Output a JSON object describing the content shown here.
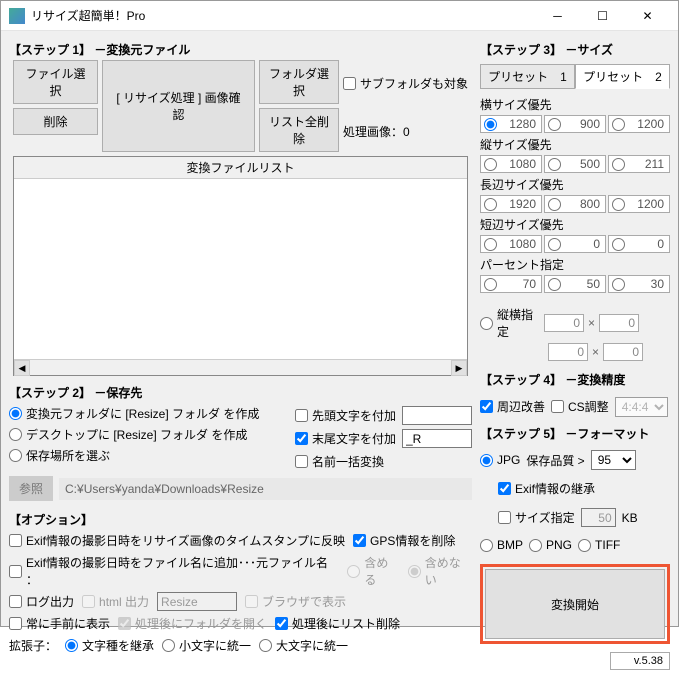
{
  "window": {
    "title": "リサイズ超簡単！Pro"
  },
  "step1": {
    "title": "【ステップ 1】 －変換元ファイル",
    "file_select": "ファイル選択",
    "delete": "削除",
    "resize_confirm": "[ リサイズ処理 ] 画像確認",
    "folder_select": "フォルダ選択",
    "list_delete_all": "リスト全削除",
    "subfolder": "サブフォルダも対象",
    "proc_images_label": "処理画像：",
    "proc_images_count": "0",
    "list_header": "変換ファイルリスト"
  },
  "step2": {
    "title": "【ステップ 2】 －保存先",
    "opt1": "変換元フォルダに [Resize] フォルダ を作成",
    "opt2": "デスクトップに [Resize] フォルダ を作成",
    "opt3": "保存場所を選ぶ",
    "prefix": "先頭文字を付加",
    "suffix": "末尾文字を付加",
    "suffix_val": "_R",
    "rename": "名前一括変換",
    "browse": "参照",
    "path": "C:¥Users¥yanda¥Downloads¥Resize"
  },
  "options": {
    "title": "【オプション】",
    "exif_ts": "Exif情報の撮影日時をリサイズ画像のタイムスタンプに反映",
    "gps_del": "GPS情報を削除",
    "exif_fn": "Exif情報の撮影日時をファイル名に追加･･･元ファイル名 ：",
    "include": "含める",
    "exclude": "含めない",
    "log": "ログ出力",
    "html": "html 出力",
    "html_val": "Resize",
    "browser": "ブラウザで表示",
    "topmost": "常に手前に表示",
    "open_after": "処理後にフォルダを開く",
    "del_list_after": "処理後にリスト削除",
    "ext_label": "拡張子：",
    "ext_inherit": "文字種を継承",
    "ext_lower": "小文字に統一",
    "ext_upper": "大文字に統一"
  },
  "step3": {
    "title": "【ステップ 3】 －サイズ",
    "preset1": "プリセット　1",
    "preset2": "プリセット　2",
    "横サイズ優先": [
      "1280",
      "900",
      "1200"
    ],
    "縦サイズ優先": [
      "1080",
      "500",
      "211"
    ],
    "長辺サイズ優先": [
      "1920",
      "800",
      "1200"
    ],
    "短辺サイズ優先": [
      "1080",
      "0",
      "0"
    ],
    "パーセント指定": [
      "70",
      "50",
      "30"
    ],
    "縦横指定": "縦横指定",
    "xy_x": [
      "0",
      "0"
    ],
    "xy_y": [
      "0",
      "0"
    ]
  },
  "step4": {
    "title": "【ステップ 4】 －変換精度",
    "edge": "周辺改善",
    "cs": "CS調整",
    "cs_val": "4:4:4"
  },
  "step5": {
    "title": "【ステップ 5】 －フォーマット",
    "jpg": "JPG",
    "quality_label": "保存品質 >",
    "quality_val": "95",
    "exif_inherit": "Exif情報の継承",
    "size_spec": "サイズ指定",
    "size_val": "50",
    "size_unit": "KB",
    "bmp": "BMP",
    "png": "PNG",
    "tiff": "TIFF"
  },
  "convert": "変換開始",
  "version": "v.5.38"
}
